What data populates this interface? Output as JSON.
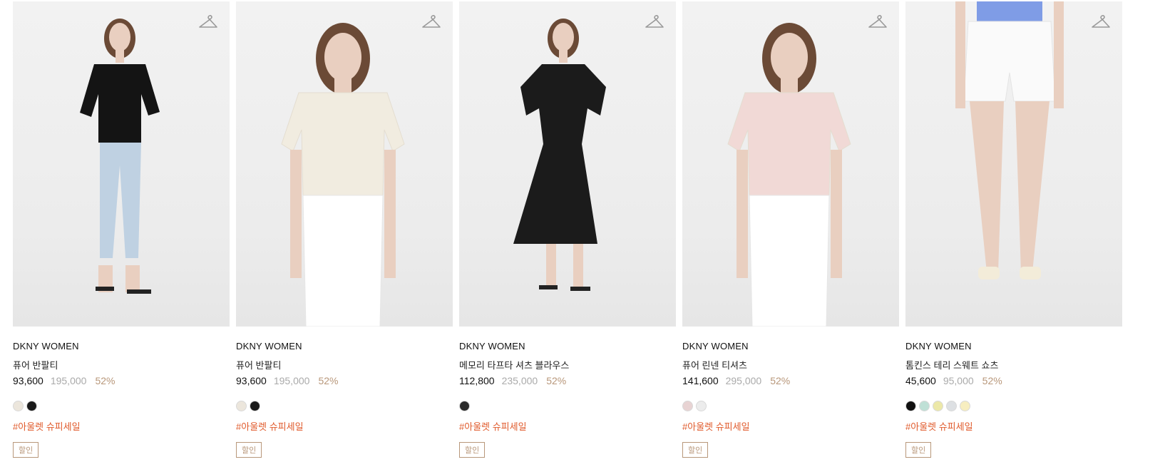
{
  "products": [
    {
      "brand": "DKNY WOMEN",
      "name": "퓨어 반팔티",
      "price": "93,600",
      "original_price": "195,000",
      "discount": "52%",
      "swatches": [
        "#ece6dc",
        "#1a1a1a"
      ],
      "tag": "#아울렛 슈피세일",
      "badge": "할인",
      "top_color": "#141414",
      "bottom_color": "#bfd1e2",
      "style": "tee-jeans"
    },
    {
      "brand": "DKNY WOMEN",
      "name": "퓨어 반팔티",
      "price": "93,600",
      "original_price": "195,000",
      "discount": "52%",
      "swatches": [
        "#ece6dc",
        "#1a1a1a"
      ],
      "tag": "#아울렛 슈피세일",
      "badge": "할인",
      "top_color": "#f1ece0",
      "bottom_color": "#ffffff",
      "style": "closeup"
    },
    {
      "brand": "DKNY WOMEN",
      "name": "메모리 타프타 셔츠 블라우스",
      "price": "112,800",
      "original_price": "235,000",
      "discount": "52%",
      "swatches": [
        "#2a2a2a"
      ],
      "tag": "#아울렛 슈피세일",
      "badge": "할인",
      "top_color": "#1b1b1b",
      "bottom_color": "#1b1b1b",
      "style": "dress"
    },
    {
      "brand": "DKNY WOMEN",
      "name": "퓨어 린넨 티셔츠",
      "price": "141,600",
      "original_price": "295,000",
      "discount": "52%",
      "swatches": [
        "#e8d3d3",
        "#ececec"
      ],
      "tag": "#아울렛 슈피세일",
      "badge": "할인",
      "top_color": "#f1d9d6",
      "bottom_color": "#ffffff",
      "style": "closeup"
    },
    {
      "brand": "DKNY WOMEN",
      "name": "톰킨스 테리 스웨트 쇼츠",
      "price": "45,600",
      "original_price": "95,000",
      "discount": "52%",
      "swatches": [
        "#111111",
        "#bfe0d6",
        "#ece8a8",
        "#dde0e3",
        "#f7eec0"
      ],
      "tag": "#아울렛 슈피세일",
      "badge": "할인",
      "top_color": "#7f9ce6",
      "bottom_color": "#fafafa",
      "style": "shorts"
    }
  ]
}
